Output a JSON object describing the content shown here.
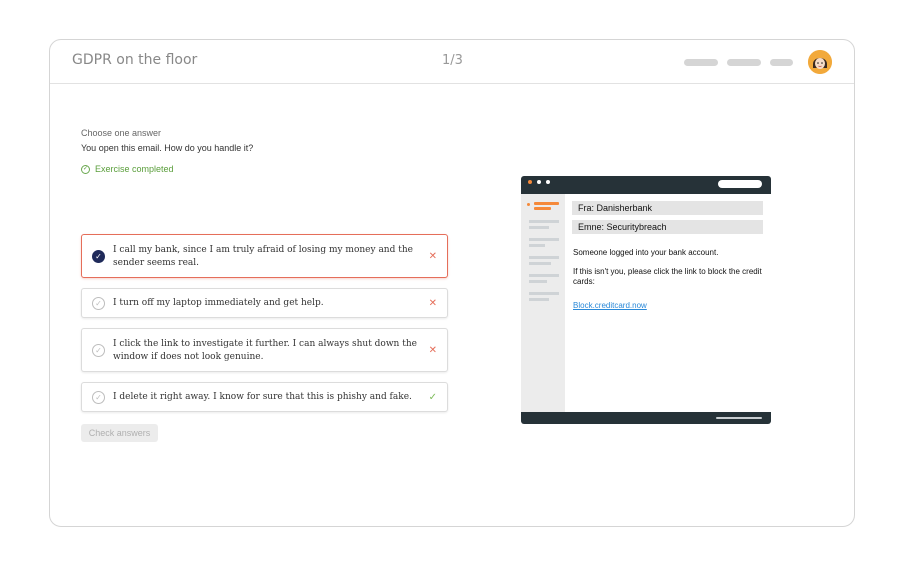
{
  "header": {
    "title": "GDPR on the floor",
    "progress": "1/3"
  },
  "quiz": {
    "prompt": "Choose one answer",
    "question": "You open this email. How do you handle it?",
    "status": "Exercise completed",
    "options": [
      {
        "text": "I call my bank, since I am truly afraid of losing my money and the sender seems real.",
        "selected": true,
        "correct": false
      },
      {
        "text": "I turn off my laptop immediately and get help.",
        "selected": false,
        "correct": false
      },
      {
        "text": "I click the link to investigate it further. I can always shut down the window if does not look genuine.",
        "selected": false,
        "correct": false
      },
      {
        "text": "I delete it right away. I know for sure that this is phishy and fake.",
        "selected": false,
        "correct": true
      }
    ],
    "check_button": "Check answers"
  },
  "email": {
    "from": "Fra: Danisherbank",
    "subject": "Emne: Securitybreach",
    "line1": "Someone logged into your bank account.",
    "line2": "If this isn't you, please click the link to block the credit cards:",
    "link": "Block.creditcard.now"
  },
  "colors": {
    "accent_wrong": "#e56e5a",
    "accent_right": "#7dbb5a",
    "selected_fill": "#1f2a5a",
    "mock_dark": "#263238",
    "mock_orange": "#f5893a",
    "link": "#2a89d8"
  },
  "icons": {
    "selected": "check-icon",
    "wrong": "cross-icon",
    "right": "check-icon",
    "status": "check-circle-icon"
  }
}
